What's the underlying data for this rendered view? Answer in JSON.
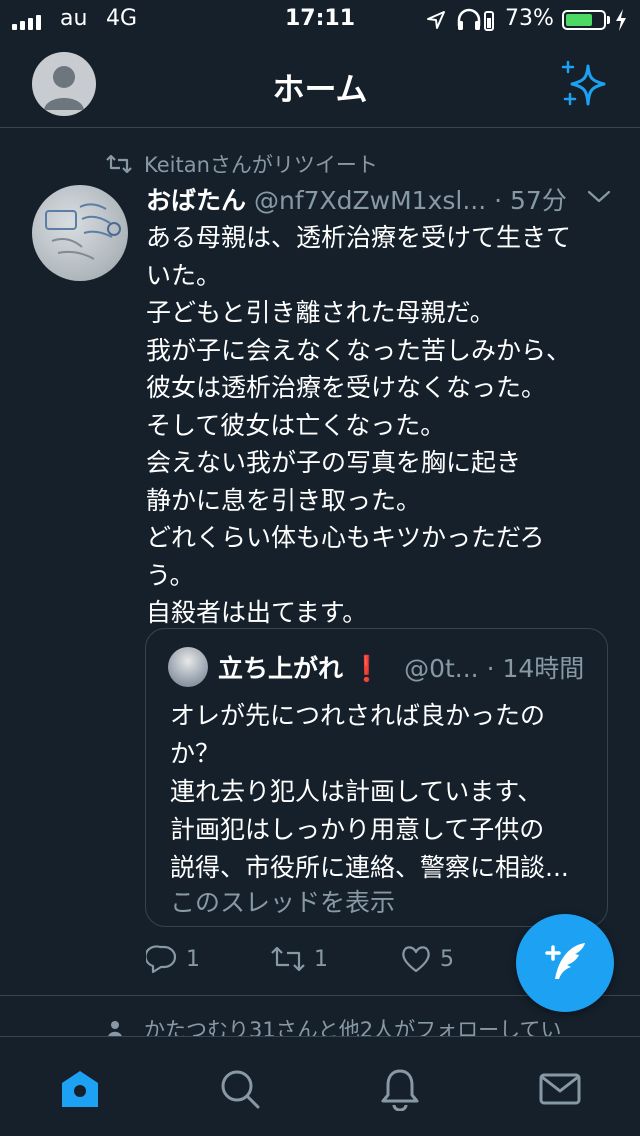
{
  "status_bar": {
    "carrier": "au",
    "network": "4G",
    "time": "17:11",
    "battery_percent": "73%",
    "battery_level": 0.73,
    "battery_color": "#4cd964"
  },
  "header": {
    "title": "ホーム",
    "left_icon": "avatar",
    "right_icon": "sparkle-icon",
    "accent_color": "#1da1f2"
  },
  "tweet": {
    "retweeted_by": "Keitanさんがリツイート",
    "author_name": "おばたん",
    "handle": "@nf7XdZwM1xsl...",
    "time": "· 57分",
    "body": "ある母親は、透析治療を受けて生きて\nいた。\n子どもと引き離された母親だ。\n我が子に会えなくなった苦しみから、\n彼女は透析治療を受けなくなった。\nそして彼女は亡くなった。\n会えない我が子の写真を胸に起き\n静かに息を引き取った。\nどれくらい体も心もキツかっただろ\nう。\n自殺者は出てます。",
    "quote": {
      "name": "立ち上がれ",
      "emoji": "❗",
      "handle": "@0t...",
      "time": "· 14時間",
      "body": "オレが先につれされば良かったの\nか？\n連れ去り犯人は計画しています、\n計画犯はしっかり用意して子供の\n説得、市役所に連絡、警察に相談...",
      "show_thread": "このスレッドを表示"
    },
    "actions": {
      "reply_count": "1",
      "retweet_count": "1",
      "like_count": "5"
    }
  },
  "next_item": {
    "context": "かたつむり31さんと他2人がフォローしてい"
  },
  "tabbar": {
    "tabs": [
      "home-icon",
      "search-icon",
      "bell-icon",
      "mail-icon"
    ],
    "active_color": "#1da1f2"
  }
}
